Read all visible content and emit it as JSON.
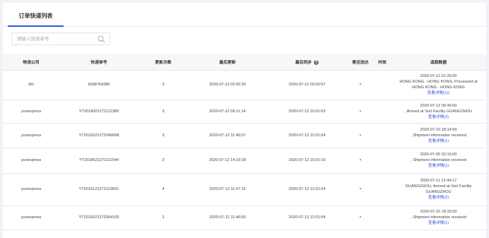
{
  "tabs": [
    {
      "label": "订单快递列表"
    }
  ],
  "search": {
    "placeholder": "请输入快递单号",
    "value": ""
  },
  "table": {
    "columns": [
      "物流公司",
      "快递单号",
      "更新次数",
      "最后更新",
      "最后同步",
      "是否送达",
      "时效",
      "追踪数据"
    ],
    "rows": [
      {
        "company": "dhl",
        "tracking_no": "6698764380",
        "updates": "3",
        "last_update": "2020-07-12 02:50:30",
        "last_sync": "2020-07-12 03:00:57",
        "delivered": "×",
        "timeliness": "",
        "track_lines": [
          "2020-07-12 01:25:00",
          "HONG KONG - HONG KONG, Processed at",
          "HONG KONG - HONG KONG"
        ],
        "detail_link": "查看详情(11)"
      },
      {
        "company": "yunexpress",
        "tracking_no": "YT2018021272112389",
        "updates": "3",
        "last_update": "2020-07-12 09:11:14",
        "last_sync": "2020-07-12 10:01:03",
        "delivered": "×",
        "timeliness": "",
        "track_lines": [
          "2020-07-12 05:46:00",
          ", Arrived at Sort Facility GUANGZHOU"
        ],
        "detail_link": "查看详情(2)"
      },
      {
        "company": "yunexpress",
        "tracking_no": "YT2019221272049098",
        "updates": "3",
        "last_update": "2020-07-12 11:46:57",
        "last_sync": "2020-07-12 12:01:04",
        "delivered": "×",
        "timeliness": "",
        "track_lines": [
          "2020-07-10 18:14:00",
          ", Shipment information received"
        ],
        "detail_link": "查看详情(1)"
      },
      {
        "company": "yunexpress",
        "tracking_no": "YT2018621272111544",
        "updates": "2",
        "last_update": "2020-07-12 14:19:39",
        "last_sync": "2020-07-12 15:01:16",
        "delivered": "×",
        "timeliness": "",
        "track_lines": [
          "2020-07-05 02:15:00",
          ", Shipment information received"
        ],
        "detail_link": "查看详情(1)"
      },
      {
        "company": "yunexpress",
        "tracking_no": "YT2019121272123691",
        "updates": "4",
        "last_update": "2020-07-12 11:47:16",
        "last_sync": "2020-07-12 12:01:04",
        "delivered": "×",
        "timeliness": "",
        "track_lines": [
          "2020-07-11 21:44:17",
          "GUANGZHOU, Arrived at Sort Facility",
          "GUANGZHOU"
        ],
        "detail_link": "查看详情(2)"
      },
      {
        "company": "yunexpress",
        "tracking_no": "YT2019221272054105",
        "updates": "2",
        "last_update": "2020-07-12 11:46:50",
        "last_sync": "2020-07-12 12:01:04",
        "delivered": "×",
        "timeliness": "",
        "track_lines": [
          "2020-07-10 18:32:00",
          ", Shipment information received"
        ],
        "detail_link": "查看详情(1)"
      }
    ]
  }
}
